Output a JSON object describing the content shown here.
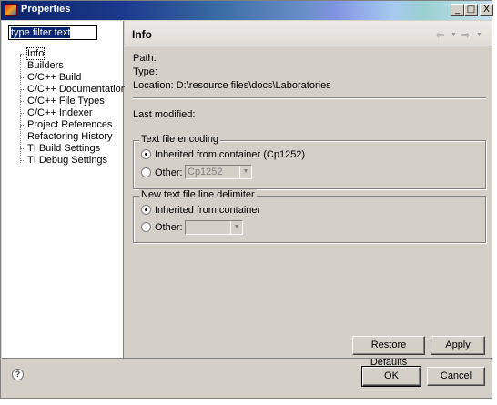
{
  "window": {
    "title": "Properties",
    "controls": {
      "minimize": "_",
      "maximize": "□",
      "close": "X"
    }
  },
  "filter": {
    "value": "type filter text"
  },
  "tree": {
    "items": [
      {
        "label": "Info",
        "selected": true
      },
      {
        "label": "Builders"
      },
      {
        "label": "C/C++ Build"
      },
      {
        "label": "C/C++ Documentation"
      },
      {
        "label": "C/C++ File Types"
      },
      {
        "label": "C/C++ Indexer"
      },
      {
        "label": "Project References"
      },
      {
        "label": "Refactoring History"
      },
      {
        "label": "TI Build Settings"
      },
      {
        "label": "TI Debug Settings"
      }
    ]
  },
  "page": {
    "title": "Info",
    "nav": {
      "back": "⇦",
      "forward": "⇨",
      "dropdown": "▼"
    },
    "path_label": "Path:",
    "type_label": "Type:",
    "location_label": "Location:",
    "location_value": "D:\\resource files\\docs\\Laboratories",
    "last_modified_label": "Last modified:"
  },
  "encoding": {
    "group_label": "Text file encoding",
    "inherited_label": "Inherited from container (Cp1252)",
    "other_label": "Other:",
    "other_value": "Cp1252"
  },
  "delimiter": {
    "group_label": "New text file line delimiter",
    "inherited_label": "Inherited from container",
    "other_label": "Other:",
    "other_value": ""
  },
  "buttons": {
    "restore_defaults": "Restore Defaults",
    "apply": "Apply",
    "ok": "OK",
    "cancel": "Cancel",
    "help": "?"
  }
}
